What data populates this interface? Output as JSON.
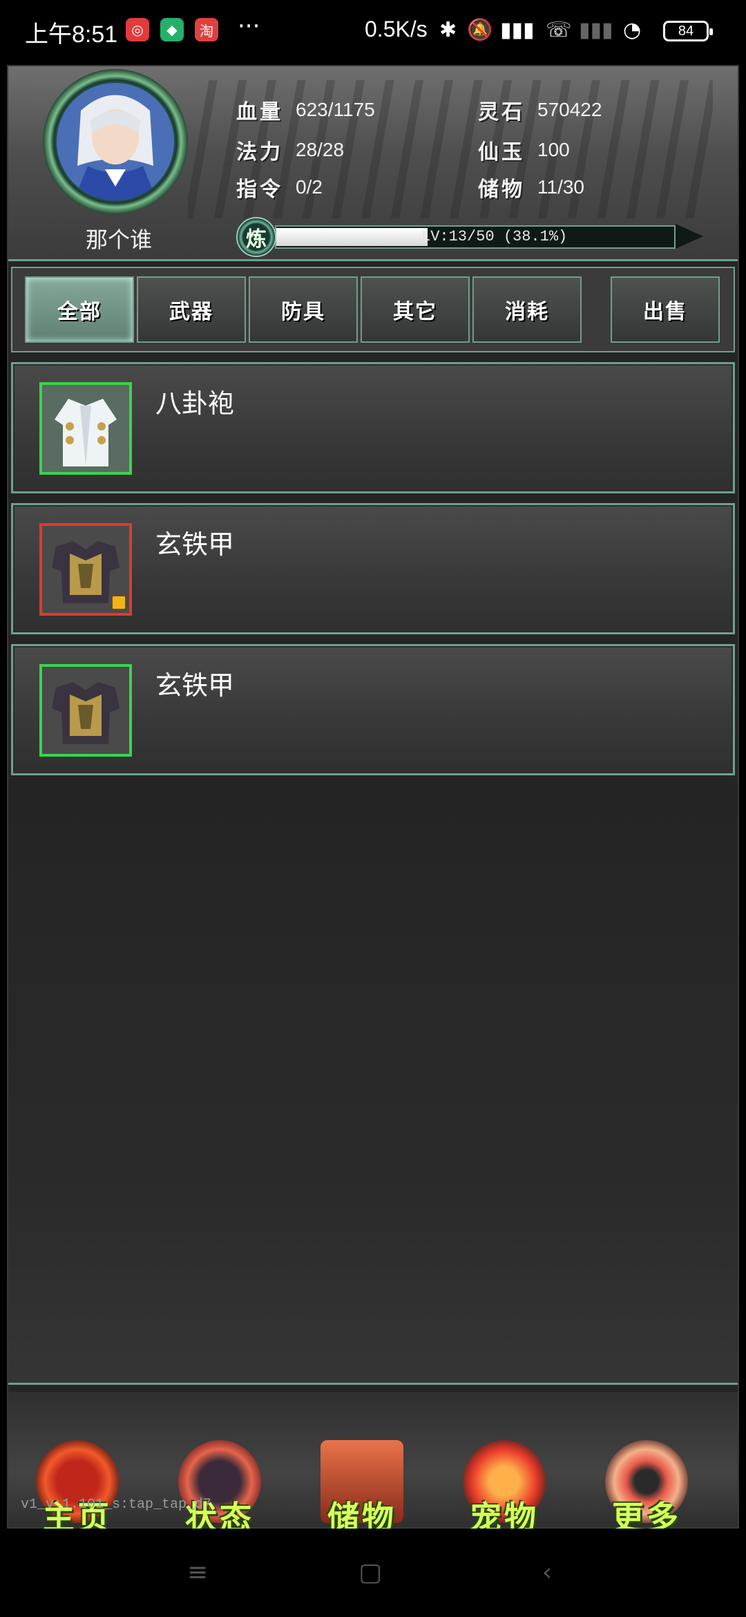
{
  "status_bar": {
    "time": "上午8:51",
    "apps": [
      "app-icon-red",
      "app-icon-green",
      "taobao-icon"
    ],
    "more": "···",
    "net_speed": "0.5K/s",
    "battery": "84"
  },
  "player": {
    "name": "那个谁",
    "stats": [
      {
        "label": "血量",
        "value": "623/1175"
      },
      {
        "label": "灵石",
        "value": "570422"
      },
      {
        "label": "法力",
        "value": "28/28"
      },
      {
        "label": "仙玉",
        "value": "100"
      },
      {
        "label": "指令",
        "value": "0/2"
      },
      {
        "label": "储物",
        "value": "11/30"
      }
    ],
    "refine_badge": "炼",
    "level_text": "LV:13/50 (38.1%)",
    "level_progress": 0.381
  },
  "tabs": [
    {
      "label": "全部",
      "active": true
    },
    {
      "label": "武器",
      "active": false
    },
    {
      "label": "防具",
      "active": false
    },
    {
      "label": "其它",
      "active": false
    },
    {
      "label": "消耗",
      "active": false
    },
    {
      "label": "出售",
      "active": false
    }
  ],
  "items": [
    {
      "name": "八卦袍",
      "rarity": "green",
      "icon": "robe-icon",
      "locked": false
    },
    {
      "name": "玄铁甲",
      "rarity": "red",
      "icon": "armor-icon",
      "locked": true
    },
    {
      "name": "玄铁甲",
      "rarity": "green",
      "icon": "armor-icon",
      "locked": false
    }
  ],
  "bottom_nav": [
    {
      "label": "主页",
      "icon": "home-emblem-icon"
    },
    {
      "label": "状态",
      "icon": "status-emblem-icon"
    },
    {
      "label": "储物",
      "icon": "storage-emblem-icon"
    },
    {
      "label": "宠物",
      "icon": "pet-phoenix-icon"
    },
    {
      "label": "更多",
      "icon": "more-emblem-icon"
    }
  ],
  "version": "v1_v:1.101_s:tap_tap_d7",
  "colors": {
    "frame_accent": "#6fa08d",
    "rarity_green": "#37d64b",
    "rarity_red": "#e13a2c",
    "nav_label": "#d8ff5a"
  }
}
